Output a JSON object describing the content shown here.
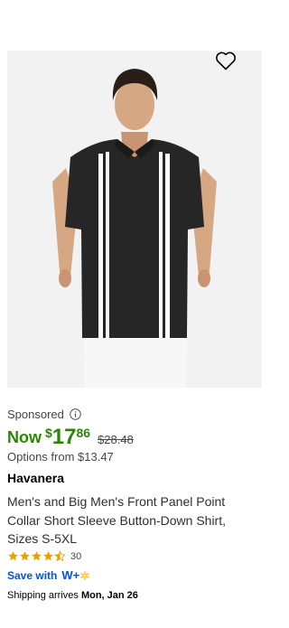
{
  "product": {
    "sponsored_label": "Sponsored",
    "price_prefix": "Now",
    "price_currency": "$",
    "price_dollars": "17",
    "price_cents": "86",
    "was_price": "$28.48",
    "options_text": "Options from $13.47",
    "brand": "Havanera",
    "title": "Men's and Big Men's Front Panel Point Collar Short Sleeve Button-Down Shirt, Sizes S-5XL",
    "rating": 4.5,
    "rating_count": "30",
    "save_with_label": "Save with",
    "wplus_logo_text": "W+",
    "shipping_prefix": "Shipping arrives",
    "shipping_date": "Mon, Jan 26"
  },
  "icons": {
    "favorite": "heart-outline-icon",
    "info": "info-circle-icon",
    "stars": "star-icon"
  },
  "colors": {
    "price_green": "#2a8703",
    "link_blue": "#0053e2",
    "star_gold": "#e5a201",
    "wplus_yellow": "#ffc220"
  }
}
